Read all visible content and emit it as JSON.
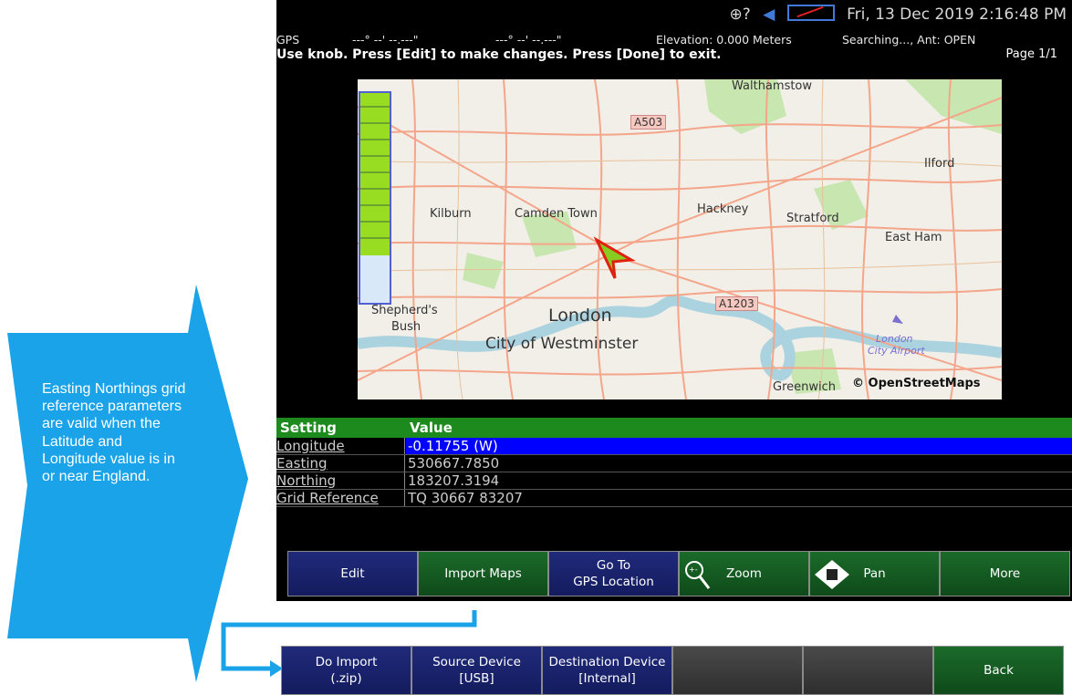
{
  "callout": {
    "text": "Easting Northings grid reference parameters are valid when the Latitude and Longitude value is in or near England.",
    "color": "#1aa3e8"
  },
  "status": {
    "datetime": "Fri, 13 Dec 2019 2:16:48 PM"
  },
  "gps": {
    "label": "GPS",
    "latitude": "---° --' --.---\"",
    "longitude": "---° --' --.---\"",
    "elevation": "Elevation: 0.000 Meters",
    "state": "Searching..., Ant: OPEN"
  },
  "instruction": "Use knob. Press [Edit] to make changes. Press [Done] to exit.",
  "page": "Page 1/1",
  "map": {
    "labels": [
      "Walthamstow",
      "A503",
      "Ilford",
      "Kilburn",
      "Camden Town",
      "Hackney",
      "Stratford",
      "East Ham",
      "A1203",
      "Shepherd's",
      "Bush",
      "London",
      "City of Westminster",
      "London",
      "City Airport",
      "Greenwich",
      "© OpenStreetMaps"
    ],
    "colors": {
      "land": "#f2efe9",
      "park": "#c8e6b0",
      "water": "#aad3df",
      "road": "#f4a58a"
    }
  },
  "table": {
    "headers": [
      "Setting",
      "Value"
    ],
    "rows": [
      {
        "setting": "Longitude",
        "value": "-0.11755 (W)",
        "selected": true
      },
      {
        "setting": "Easting",
        "value": "530667.7850"
      },
      {
        "setting": "Northing",
        "value": "183207.3194"
      },
      {
        "setting": "Grid Reference",
        "value": "TQ 30667 83207"
      }
    ]
  },
  "softkeys_main": [
    {
      "label": "Edit",
      "style": "blue"
    },
    {
      "label": "Import Maps",
      "style": "green"
    },
    {
      "label": "Go To\nGPS Location",
      "style": "blue"
    },
    {
      "label": "Zoom",
      "style": "green",
      "icon": "zoom-icon"
    },
    {
      "label": "Pan",
      "style": "green",
      "icon": "pan-icon"
    },
    {
      "label": "More",
      "style": "green"
    }
  ],
  "softkeys_import": [
    {
      "label": "Do Import\n(.zip)",
      "style": "blue"
    },
    {
      "label": "Source Device\n[USB]",
      "style": "blue"
    },
    {
      "label": "Destination Device\n[Internal]",
      "style": "blue"
    },
    {
      "label": "",
      "style": "gray"
    },
    {
      "label": "",
      "style": "gray"
    },
    {
      "label": "Back",
      "style": "green"
    }
  ]
}
